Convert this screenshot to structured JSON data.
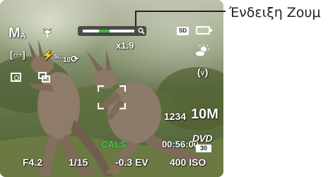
{
  "callout": {
    "label": "Ένδειξη Ζουμ"
  },
  "osd": {
    "mode_icon": "manual-mode-icon",
    "macro_icon": "macro-tulip-icon",
    "zoom": {
      "ratio": "x1.9",
      "level": 0.3
    },
    "storage_badge": "SD",
    "battery_icon": "battery-icon",
    "focus_icon": "multi-focus-icon",
    "flash_icon": "flash-off-icon",
    "self_timer": "10",
    "white_balance_icon": "cloudy-wb-icon",
    "stabilizer_icon": "stabilizer-icon",
    "face_detect_icon": "face-detect-icon",
    "continuous_icon": "continuous-shot-icon",
    "shots_remaining": "1234",
    "image_size": "10M",
    "cals": "CALS",
    "record_time": "00:56:00",
    "video_format": "DVD",
    "video_fps": "30",
    "aperture": "F4.2",
    "shutter": "1/15",
    "exposure": "-0.3 EV",
    "iso": "400 ISO"
  }
}
